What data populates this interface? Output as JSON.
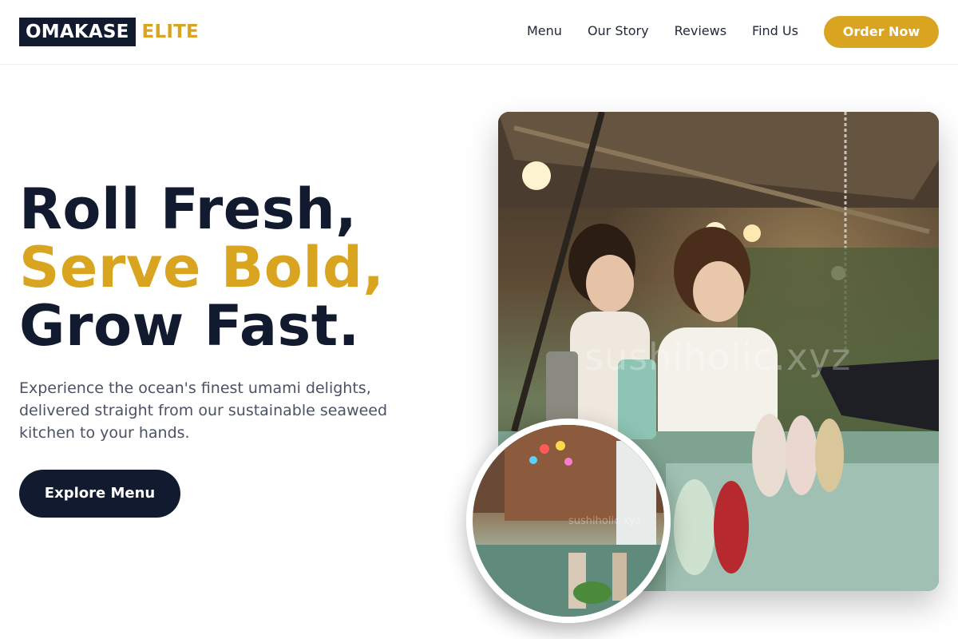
{
  "brand": {
    "name_dark": "OMAKASE",
    "name_gold": "ELITE"
  },
  "nav": {
    "items": [
      "Menu",
      "Our Story",
      "Reviews",
      "Find Us"
    ]
  },
  "header": {
    "cta_label": "Order Now"
  },
  "hero": {
    "title_line1": "Roll Fresh,",
    "title_line2": "Serve Bold,",
    "title_line3": "Grow Fast.",
    "subtitle": "Experience the ocean's finest umami delights, delivered straight from our sustainable seaweed kitchen to your hands.",
    "cta_label": "Explore Menu"
  },
  "images": {
    "main_watermark": "sushiholic.xyz",
    "circle_watermark": "sushiholic.xyz"
  },
  "colors": {
    "navy": "#111a2e",
    "gold": "#d9a521",
    "muted_text": "#4a5263"
  }
}
